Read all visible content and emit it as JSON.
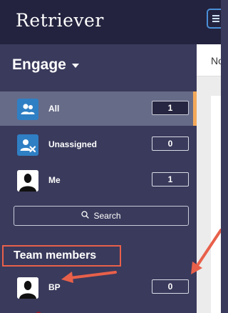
{
  "app": {
    "logo_text": "Retriever"
  },
  "sidebar": {
    "title": "Engage",
    "items": [
      {
        "label": "All",
        "count": "1",
        "icon": "users-icon",
        "selected": true
      },
      {
        "label": "Unassigned",
        "count": "0",
        "icon": "user-remove-icon",
        "selected": false
      },
      {
        "label": "Me",
        "count": "1",
        "icon": "person-avatar",
        "selected": false
      }
    ],
    "search_label": "Search",
    "team_section_label": "Team members",
    "team_members": [
      {
        "label": "BP",
        "count": "0",
        "status_color": "#8b1a2b"
      }
    ]
  },
  "main": {
    "tab_text": "No"
  },
  "colors": {
    "topbar": "#23233f",
    "sidebar": "#3a3a5c",
    "selected_row": "#666b88",
    "selected_accent": "#f3a95a",
    "annotation": "#e8604a",
    "menu_button_border": "#4a8fd8"
  }
}
